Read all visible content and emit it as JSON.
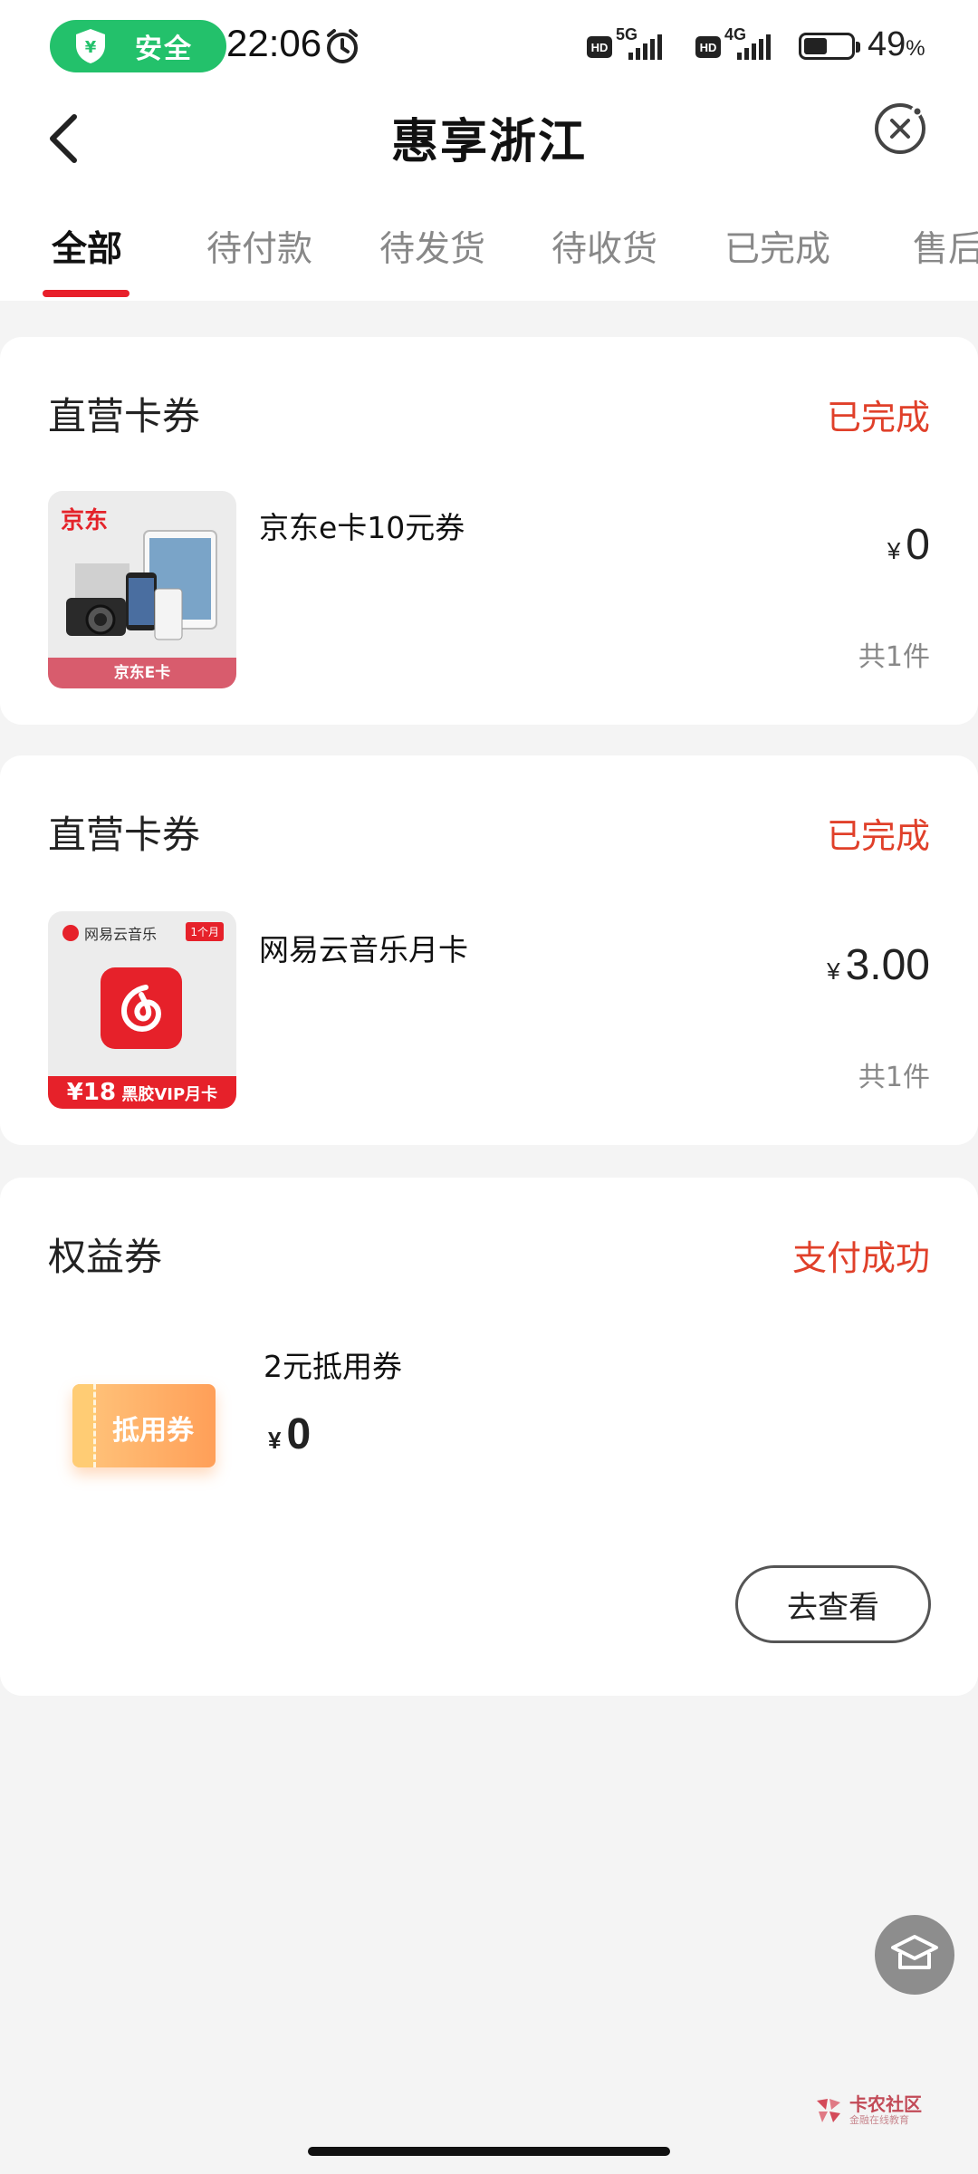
{
  "status_bar": {
    "safe_label": "安全",
    "time": "22:06",
    "net1": "5G",
    "net2": "4G",
    "hd": "HD",
    "battery_percent": "49",
    "battery_unit": "%",
    "battery_level": 0.49,
    "safe_color": "#23c16b"
  },
  "header": {
    "title": "惠享浙江",
    "back_icon": "chevron-left-icon",
    "close_icon": "close-circle-icon"
  },
  "tabs": [
    {
      "label": "全部",
      "active": true
    },
    {
      "label": "待付款",
      "active": false
    },
    {
      "label": "待发货",
      "active": false
    },
    {
      "label": "待收货",
      "active": false
    },
    {
      "label": "已完成",
      "active": false
    },
    {
      "label": "售后",
      "active": false
    }
  ],
  "orders": [
    {
      "shop": "直营卡券",
      "status": "已完成",
      "item": {
        "name": "京东e卡10元券",
        "currency": "¥",
        "price": "0",
        "quantity": "共1件",
        "thumb_brand": "京东",
        "thumb_band": "京东E卡"
      }
    },
    {
      "shop": "直营卡券",
      "status": "已完成",
      "item": {
        "name": "网易云音乐月卡",
        "currency": "¥",
        "price": "3.00",
        "quantity": "共1件",
        "thumb_brand": "网易云音乐",
        "thumb_tag": "1个月",
        "thumb_band_amount": "¥18",
        "thumb_band_text": "黑胶VIP月卡"
      }
    },
    {
      "shop": "权益券",
      "status": "支付成功",
      "item": {
        "name": "2元抵用券",
        "currency": "¥",
        "price": "0",
        "thumb_label": "抵用券"
      },
      "action": "去查看"
    }
  ],
  "watermark": {
    "main": "卡农社区",
    "sub": "金融在线教育"
  },
  "colors": {
    "accent": "#e8202b",
    "status_text": "#e0402a"
  }
}
